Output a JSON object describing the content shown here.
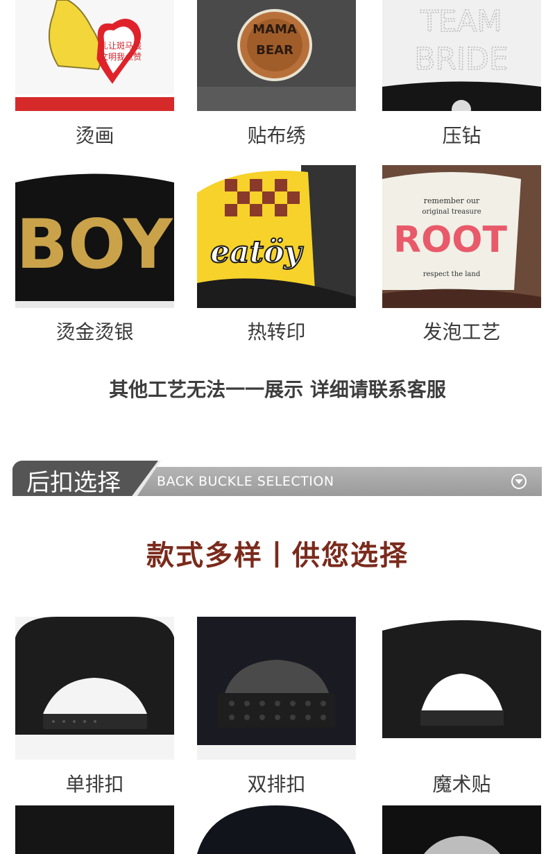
{
  "crafts": [
    {
      "label": "烫画",
      "art": "礼让斑马线\n文明我点赞"
    },
    {
      "label": "贴布绣",
      "art": "MAMA\nBEAR"
    },
    {
      "label": "压钻",
      "art": "TEAM\nBRIDE"
    },
    {
      "label": "烫金烫银",
      "art": "BOY"
    },
    {
      "label": "热转印",
      "art": "eatöy"
    },
    {
      "label": "发泡工艺",
      "art": "ROOT",
      "art_small": "remember our original treasure",
      "art_small2": "respect the land"
    }
  ],
  "note": "其他工艺无法一一展示 详细请联系客服",
  "section_banner": {
    "title_cn": "后扣选择",
    "title_en": "BACK BUCKLE SELECTION",
    "icon": "chevron-down-circle-icon"
  },
  "slogan": "款式多样丨供您选择",
  "buckles": [
    {
      "label": "单排扣"
    },
    {
      "label": "双排扣"
    },
    {
      "label": "魔术贴"
    }
  ],
  "colors": {
    "slogan": "#7a2a1c",
    "banner_tab": "#555555",
    "banner_bar": "#a8a8a8",
    "caption": "#3a3a3a"
  }
}
